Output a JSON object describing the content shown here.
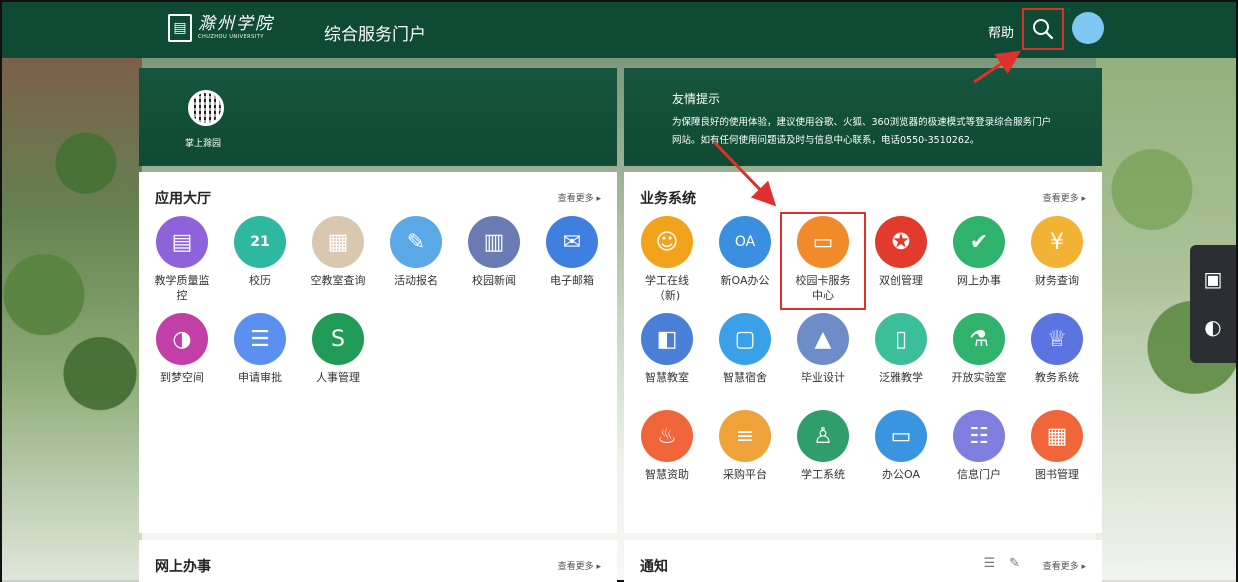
{
  "header": {
    "logo_cn": "滁州学院",
    "logo_en": "CHUZHOU UNIVERSITY",
    "portal_title": "综合服务门户",
    "help": "帮助"
  },
  "banner_left": {
    "qr_label": "掌上滁园"
  },
  "banner_right": {
    "title": "友情提示",
    "text": "为保障良好的使用体验，建议使用谷歌、火狐、360浏览器的极速模式等登录综合服务门户网站。如有任何使用问题请及时与信息中心联系，电话0550-3510262。"
  },
  "apps_panel": {
    "title": "应用大厅",
    "more": "查看更多",
    "items": [
      {
        "label": "教学质量监控",
        "icon": "monitor-icon",
        "color": "#8e63d9"
      },
      {
        "label": "校历",
        "icon": "calendar-icon",
        "color": "#2fb8a0"
      },
      {
        "label": "空教室查询",
        "icon": "classroom-icon",
        "color": "#d9c7b0"
      },
      {
        "label": "活动报名",
        "icon": "signup-icon",
        "color": "#5aa9e6"
      },
      {
        "label": "校园新闻",
        "icon": "news-icon",
        "color": "#6a7bb3"
      },
      {
        "label": "电子邮箱",
        "icon": "mail-icon",
        "color": "#3f7fe0"
      },
      {
        "label": "到梦空间",
        "icon": "dream-icon",
        "color": "#c23fa8"
      },
      {
        "label": "申请审批",
        "icon": "approve-icon",
        "color": "#5b8ff0"
      },
      {
        "label": "人事管理",
        "icon": "hr-icon",
        "color": "#1f9a57"
      }
    ]
  },
  "biz_panel": {
    "title": "业务系统",
    "more": "查看更多",
    "items": [
      {
        "label": "学工在线（新)",
        "icon": "graduate-icon",
        "color": "#f2a21b"
      },
      {
        "label": "新OA办公",
        "icon": "oa-icon",
        "color": "#3a8fe0"
      },
      {
        "label": "校园卡服务中心",
        "icon": "campus-card-icon",
        "color": "#f08a2a"
      },
      {
        "label": "双创管理",
        "icon": "innovation-icon",
        "color": "#e23b2e"
      },
      {
        "label": "网上办事",
        "icon": "check-icon",
        "color": "#2fb36c"
      },
      {
        "label": "财务查询",
        "icon": "finance-icon",
        "color": "#f2b233"
      },
      {
        "label": "智慧教室",
        "icon": "door-icon",
        "color": "#4a7fd8"
      },
      {
        "label": "智慧宿舍",
        "icon": "dorm-icon",
        "color": "#3aa0e8"
      },
      {
        "label": "毕业设计",
        "icon": "cap-icon",
        "color": "#6e8cc8"
      },
      {
        "label": "泛雅教学",
        "icon": "book-icon",
        "color": "#3bbf9a"
      },
      {
        "label": "开放实验室",
        "icon": "flask-icon",
        "color": "#2fb36c"
      },
      {
        "label": "教务系统",
        "icon": "hat-icon",
        "color": "#5b74e0"
      },
      {
        "label": "智慧资助",
        "icon": "aid-icon",
        "color": "#f0653a"
      },
      {
        "label": "采购平台",
        "icon": "clipboard-icon",
        "color": "#f0a23a"
      },
      {
        "label": "学工系统",
        "icon": "student-icon",
        "color": "#2f9e6a"
      },
      {
        "label": "办公OA",
        "icon": "desktop-icon",
        "color": "#3a95e0"
      },
      {
        "label": "信息门户",
        "icon": "info-icon",
        "color": "#7f7fe0"
      },
      {
        "label": "图书管理",
        "icon": "library-icon",
        "color": "#f0663a"
      }
    ]
  },
  "online_panel": {
    "title": "网上办事",
    "more": "查看更多"
  },
  "notice_panel": {
    "title": "通知",
    "more": "查看更多"
  }
}
